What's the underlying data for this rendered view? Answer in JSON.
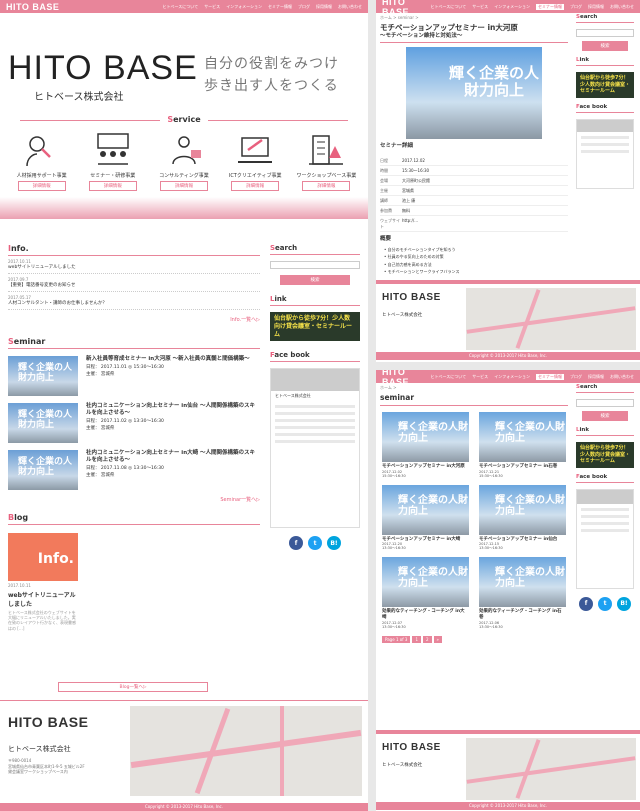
{
  "header": {
    "logo": "HITO BASE",
    "nav": [
      "ヒトベースについて",
      "サービス",
      "インフォメーション",
      "セミナー情報",
      "ブログ",
      "採用情報",
      "お問い合わせ"
    ]
  },
  "hero": {
    "brand": "HITO BASE",
    "company": "ヒトベース株式会社",
    "tagline1": "自分の役割をみつけ",
    "tagline2": "歩き出す人をつくる"
  },
  "service": {
    "title_first": "S",
    "title_rest": "ervice",
    "items": [
      {
        "label": "人材採用サポート事業",
        "icon": "recruit-icon",
        "button": "詳細情報"
      },
      {
        "label": "セミナー・研修事業",
        "icon": "seminar-icon",
        "button": "詳細情報"
      },
      {
        "label": "コンサルティング事業",
        "icon": "consulting-icon",
        "button": "詳細情報"
      },
      {
        "label": "ICTクリエイティブ事業",
        "icon": "ict-icon",
        "button": "詳細情報"
      },
      {
        "label": "ワークショップベース事業",
        "icon": "workshop-icon",
        "button": "詳細情報"
      }
    ]
  },
  "info": {
    "title_first": "I",
    "title_rest": "nfo.",
    "items": [
      {
        "date": "2017.10.11",
        "text": "webサイトリニューアルしました"
      },
      {
        "date": "2017.09.7",
        "text": "【重要】電話番号変更のお知らせ"
      },
      {
        "date": "2017.05.17",
        "text": "人材コンサルタント・講師のお仕事しませんか？"
      }
    ],
    "more": "Info.一覧へ▷"
  },
  "seminar": {
    "title_first": "S",
    "title_rest": "eminar",
    "thumb_text": "輝く企業の人財力向上",
    "items": [
      {
        "title": "新入社員等育成セミナー in大河原 〜新入社員の真髄と間価構築〜",
        "date": "日程： 2017.11.01 ◎ 15:30〜16:30",
        "org": "主催： 宮城県"
      },
      {
        "title": "社内コミュニケーション向上セミナー in仙台 〜人間関係構築のスキルを向上させる〜",
        "date": "日程： 2017.11.02 ◎ 13:30〜16:30",
        "org": "主催： 宮城県"
      },
      {
        "title": "社内コミュニケーション向上セミナー in大崎 〜人間関係構築のスキルを向上させる〜",
        "date": "日程： 2017.11.08 ◎ 13:30〜16:30",
        "org": "主催： 宮城県"
      }
    ],
    "more": "Seminar一覧へ▷"
  },
  "blog": {
    "title_first": "B",
    "title_rest": "log",
    "image_text": "Info.",
    "date": "2017.10.11",
    "title": "webサイトリニューアルしました",
    "excerpt": "ヒトベース株式会社のウェブサイトを大幅にリニューアルいたしました。実在致のレイアウト行かなく、表現書感はの […]",
    "more": "Blog一覧へ▷"
  },
  "sidebar": {
    "search_title_first": "S",
    "search_title_rest": "earch",
    "search_button": "検索",
    "link_title_first": "L",
    "link_title_rest": "ink",
    "banner": "仙台駅から徒歩7分！少人数向け貸会議室・セミナールーム",
    "fb_title_first": "F",
    "fb_title_rest": "ace book",
    "fb_name": "ヒトベース株式会社",
    "social": [
      "f",
      "t",
      "B!"
    ]
  },
  "footer": {
    "logo": "HITO BASE",
    "company": "ヒトベース株式会社",
    "zip": "〒980-0014",
    "address": "宮城県仙台市青葉区本町1-9-5 五城ビル2F",
    "address2": "貸会議室ワークショップベース内",
    "copyright": "Copyright © 2013-2017 Hito Base, Inc."
  },
  "detail": {
    "crumb": "ホーム > seminar >",
    "title": "モチベーションアップセミナー in大河原",
    "subtitle": "〜モチベーション維持と対処法〜",
    "image_text": "輝く企業の人財力向上",
    "section": "セミナー詳細",
    "rows": [
      [
        "日程",
        "2017.12.02"
      ],
      [
        "時間",
        "15:30〜16:30"
      ],
      [
        "会場",
        "大河原町公民館"
      ],
      [
        "主催",
        "宮城県"
      ],
      [
        "講師",
        "池上 康"
      ],
      [
        "参加費",
        "無料"
      ],
      [
        "ウェブサイト",
        "http://..."
      ]
    ],
    "overview": "概要",
    "bullets": [
      "自分のモチベーションタイプを知ろう",
      "社員のやる気向上のための対策",
      "自己効力感を高める方法",
      "モチベーションとワークライフバランス"
    ]
  },
  "list": {
    "crumb": "ホーム >",
    "title": "seminar",
    "image_text": "輝く企業の人財力向上",
    "items": [
      {
        "title": "モチベーションアップセミナー in大河原",
        "date": "2017.12.02",
        "time": "15:30〜16:30"
      },
      {
        "title": "モチベーションアップセミナー in石巻",
        "date": "2017.12.21",
        "time": "15:30〜16:30"
      },
      {
        "title": "モチベーションアップセミナー in大崎",
        "date": "2017.12.20",
        "time": "13:30〜16:30"
      },
      {
        "title": "モチベーションアップセミナー in仙台",
        "date": "2017.12.15",
        "time": "13:30〜16:30"
      },
      {
        "title": "効果的なティーチング・コーチング in大崎",
        "date": "2017.12.07",
        "time": "13:30〜16:30"
      },
      {
        "title": "効果的なティーチング・コーチング in石巻",
        "date": "2017.12.06",
        "time": "13:30〜16:30"
      }
    ],
    "pager": [
      "Page 1 of 3",
      "1",
      "2",
      "»"
    ]
  },
  "colors": {
    "accent": "#e8859a",
    "accent_dark": "#e8607e"
  }
}
